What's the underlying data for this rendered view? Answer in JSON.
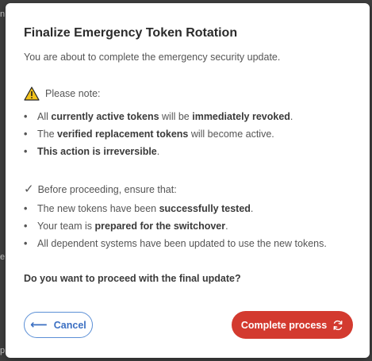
{
  "dialog": {
    "title": "Finalize Emergency Token Rotation",
    "subtitle": "You are about to complete the emergency security update.",
    "note_heading": "Please note:",
    "note_items": [
      {
        "pre": "All ",
        "b1": "currently active tokens",
        "mid": " will be ",
        "b2": "immediately revoked",
        "post": "."
      },
      {
        "pre": "The ",
        "b1": "verified replacement tokens",
        "mid": " will become active.",
        "b2": "",
        "post": ""
      },
      {
        "pre": "",
        "b1": "This action is irreversible",
        "mid": ".",
        "b2": "",
        "post": ""
      }
    ],
    "check_heading": "Before proceeding, ensure that:",
    "check_items": [
      {
        "pre": "The new tokens have been ",
        "b1": "successfully tested",
        "post": "."
      },
      {
        "pre": "Your team is ",
        "b1": "prepared for the switchover",
        "post": "."
      },
      {
        "pre": "All dependent systems have been updated to use the new tokens.",
        "b1": "",
        "post": ""
      }
    ],
    "question": "Do you want to proceed with the final update?",
    "cancel_label": "Cancel",
    "complete_label": "Complete process",
    "icons": {
      "warning": "warning-icon",
      "check": "check-icon",
      "back_arrow": "arrow-left-icon",
      "refresh": "refresh-icon"
    },
    "colors": {
      "primary_danger": "#d33a2f",
      "cancel_accent": "#3b6fc2",
      "warning_fill": "#f2c21b"
    }
  },
  "background": {
    "edge_glyphs": [
      "n",
      "e",
      "p"
    ]
  }
}
